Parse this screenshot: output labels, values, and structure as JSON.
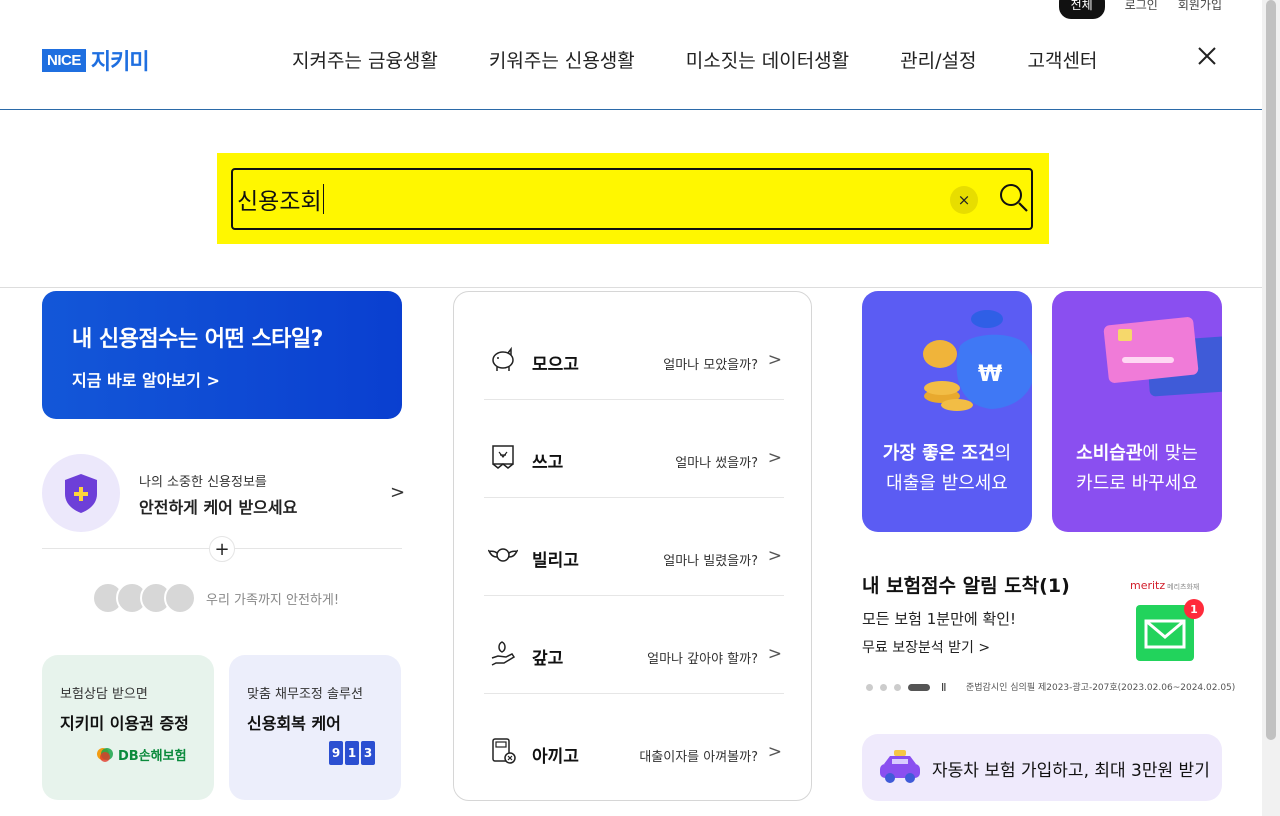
{
  "utility": {
    "active": "전체",
    "login": "로그인",
    "signup": "회원가입"
  },
  "header": {
    "logo_nice": "NICE",
    "logo_brand": "지키미",
    "nav": [
      "지켜주는 금융생활",
      "키워주는 신용생활",
      "미소짓는 데이터생활",
      "관리/설정",
      "고객센터"
    ]
  },
  "search": {
    "value": "신용조회",
    "clear_label": "×"
  },
  "left": {
    "banner_title": "내 신용점수는 어떤 스타일?",
    "banner_link": "지금 바로 알아보기 >",
    "care_line1": "나의 소중한 신용정보를",
    "care_line2": "안전하게 케어 받으세요",
    "care_arrow": ">",
    "plus": "+",
    "family_text": "우리 가족까지 안전하게!",
    "card1_sub": "보험상담 받으면",
    "card1_title": "지키미 이용권 증정",
    "card1_logo": "DB손해보험",
    "card2_sub": "맞춤 채무조정 솔루션",
    "card2_title": "신용회복 케어",
    "card2_digits": [
      "9",
      "1",
      "3"
    ]
  },
  "menu": [
    {
      "label": "모으고",
      "question": "얼마나 모았을까?",
      "icon": "piggy-bank-icon"
    },
    {
      "label": "쓰고",
      "question": "얼마나 썼을까?",
      "icon": "receipt-icon"
    },
    {
      "label": "빌리고",
      "question": "얼마나 빌렸을까?",
      "icon": "winged-money-icon"
    },
    {
      "label": "갚고",
      "question": "얼마나 갚아야 할까?",
      "icon": "hand-money-icon"
    },
    {
      "label": "아끼고",
      "question": "대출이자를 아껴볼까?",
      "icon": "calculator-icon"
    }
  ],
  "menu_arrow": ">",
  "right": {
    "promo1_strong": "가장 좋은 조건",
    "promo1_rest": "의",
    "promo1_line2": "대출을 받으세요",
    "promo2_strong": "소비습관",
    "promo2_rest": "에 맞는",
    "promo2_line2": "카드로 바꾸세요",
    "ins_title": "내 보험점수 알림 도착(1)",
    "ins_sub": "모든 보험 1분만에 확인!",
    "ins_link": "무료 보장분석 받기 >",
    "meritz": "meritz",
    "meritz_sub": "메리츠화재",
    "badge": "1",
    "pause": "II",
    "legal": "준법감시인 심의필 제2023-광고-207호(2023.02.06~2024.02.05)",
    "car_text": "자동차 보험 가입하고, 최대 3만원 받기"
  },
  "colors": {
    "brand": "#1f6fe0",
    "highlight": "#fff700",
    "promo1": "#5b5cf3",
    "promo2": "#8a4ff0"
  }
}
